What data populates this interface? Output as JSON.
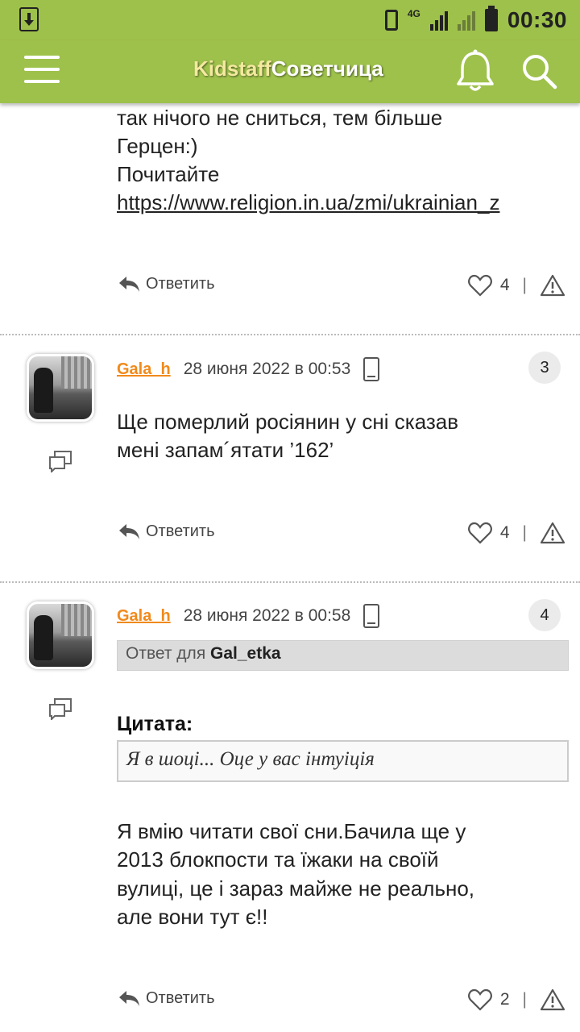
{
  "status_bar": {
    "time": "00:30",
    "network": "4G"
  },
  "header": {
    "logo_part1": "Kidstaff",
    "logo_part2": "Советчица"
  },
  "post_prev": {
    "lines": [
      "так нічого не сниться, тем більше",
      "Герцен:)",
      "Почитайте"
    ],
    "link": "https://www.religion.in.ua/zmi/ukrainian_z",
    "reply_label": "Ответить",
    "likes": "4"
  },
  "post3": {
    "author": "Gala_h",
    "date": "28 июня 2022 в 00:53",
    "number": "3",
    "lines": [
      "Ще померлий росіянин у сні сказав",
      "мені запам´ятати ’162’"
    ],
    "reply_label": "Ответить",
    "likes": "4"
  },
  "post4": {
    "author": "Gala_h",
    "date": "28 июня 2022 в 00:58",
    "number": "4",
    "reply_to_prefix": "Ответ для",
    "reply_to_user": "Gal_etka",
    "quote_title": "Цитата:",
    "quote_text": "Я в шоці... Оце у вас інтуіція",
    "lines": [
      "Я вмію читати свої сни.Бачила ще у",
      "2013 блокпости та їжаки на своїй",
      "вулиці, це і зараз майже не реально,",
      "але вони тут є!!"
    ],
    "reply_label": "Ответить",
    "likes": "2"
  }
}
